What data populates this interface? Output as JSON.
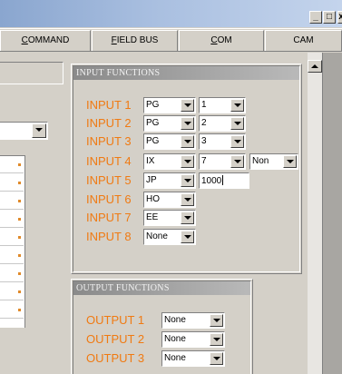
{
  "window": {
    "controls": {
      "minimize": "_",
      "maximize": "□",
      "close": "x"
    }
  },
  "tabs": [
    {
      "label": "COMMAND",
      "accel": "C",
      "rest": "OMMAND"
    },
    {
      "label": "FIELD BUS",
      "accel": "F",
      "rest": "IELD BUS"
    },
    {
      "label": "COM",
      "accel": "C",
      "rest": "OM"
    },
    {
      "label": "CAM",
      "accel": "",
      "rest": "CAM"
    }
  ],
  "input_functions": {
    "title": "INPUT FUNCTIONS",
    "rows": [
      {
        "label": "INPUT 1",
        "func": "PG",
        "param": "1"
      },
      {
        "label": "INPUT 2",
        "func": "PG",
        "param": "2"
      },
      {
        "label": "INPUT 3",
        "func": "PG",
        "param": "3"
      },
      {
        "label": "INPUT 4",
        "func": "IX",
        "param": "7",
        "extra": "Non"
      },
      {
        "label": "INPUT 5",
        "func": "JP",
        "text": "1000"
      },
      {
        "label": "INPUT 6",
        "func": "HO"
      },
      {
        "label": "INPUT 7",
        "func": "EE"
      },
      {
        "label": "INPUT 8",
        "func": "None"
      }
    ]
  },
  "output_functions": {
    "title": "OUTPUT FUNCTIONS",
    "rows": [
      {
        "label": "OUTPUT 1",
        "func": "None"
      },
      {
        "label": "OUTPUT 2",
        "func": "None"
      },
      {
        "label": "OUTPUT 3",
        "func": "None"
      }
    ]
  },
  "colors": {
    "label_orange": "#f07a12",
    "panel_gray": "#d4d0c8",
    "title_gradient": "#8a8a8a"
  }
}
